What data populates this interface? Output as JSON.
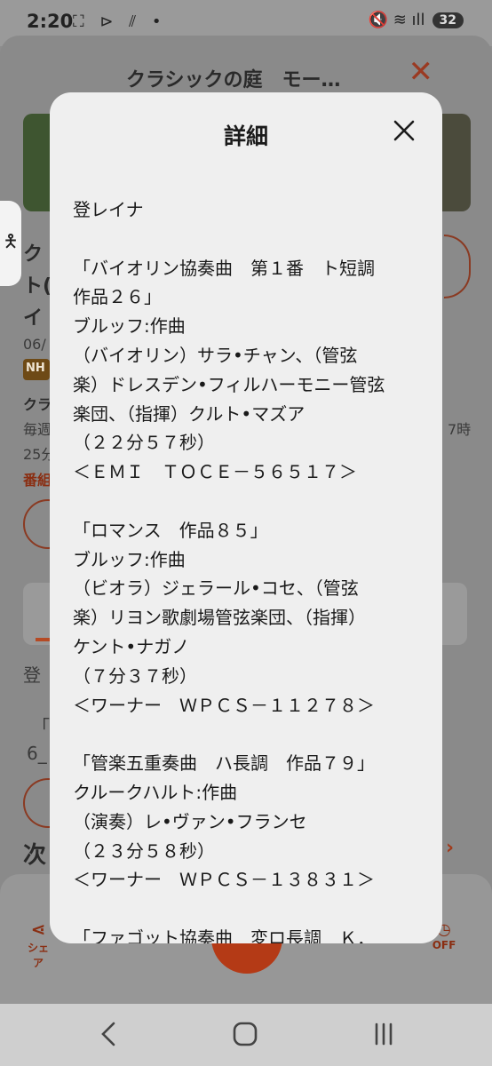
{
  "status_bar": {
    "time": "2:20",
    "left_icons": "⛶ ⊳ ⫽ •",
    "right_icons": "🔇 ≋ ıll",
    "battery": "32"
  },
  "background": {
    "title": "クラシックの庭　モー…",
    "lines": [
      "ク",
      "ト(",
      "イ",
      "06/",
      "クラ",
      "毎週",
      "25分",
      "番組",
      "登",
      "「ノ",
      "6_"
    ],
    "next_label": "次",
    "time_frag": "7時",
    "badge": "NH",
    "share_label": "シェア",
    "off_label": "OFF"
  },
  "dialog": {
    "title": "詳細",
    "body": "登レイナ\n\n「バイオリン協奏曲　第１番　ト短調\n作品２６」\nブルッフ:作曲\n（バイオリン）サラ•チャン、（管弦\n楽）ドレスデン•フィルハーモニー管弦\n楽団、（指揮）クルト•マズア\n（２２分５７秒）\n＜ＥＭＩ　ＴＯＣＥ－５６５１７＞\n\n「ロマンス　作品８５」\nブルッフ:作曲\n（ビオラ）ジェラール•コセ、（管弦\n楽）リヨン歌劇場管弦楽団、（指揮）\nケント•ナガノ\n（７分３７秒）\n＜ワーナー　ＷＰＣＳ－１１２７８＞\n\n「管楽五重奏曲　ハ長調　作品７９」\nクルークハルト:作曲\n（演奏）レ•ヴァン•フランセ\n（２３分５８秒）\n＜ワーナー　ＷＰＣＳ－１３８３１＞\n\n「ファゴット協奏曲　変ロ長調　Ｋ．"
  },
  "nav": {
    "back": "back",
    "home": "home",
    "recents": "recents"
  },
  "colors": {
    "accent": "#b54a24",
    "dialog_bg": "#efefef",
    "scrim": "#8d8d8d"
  }
}
